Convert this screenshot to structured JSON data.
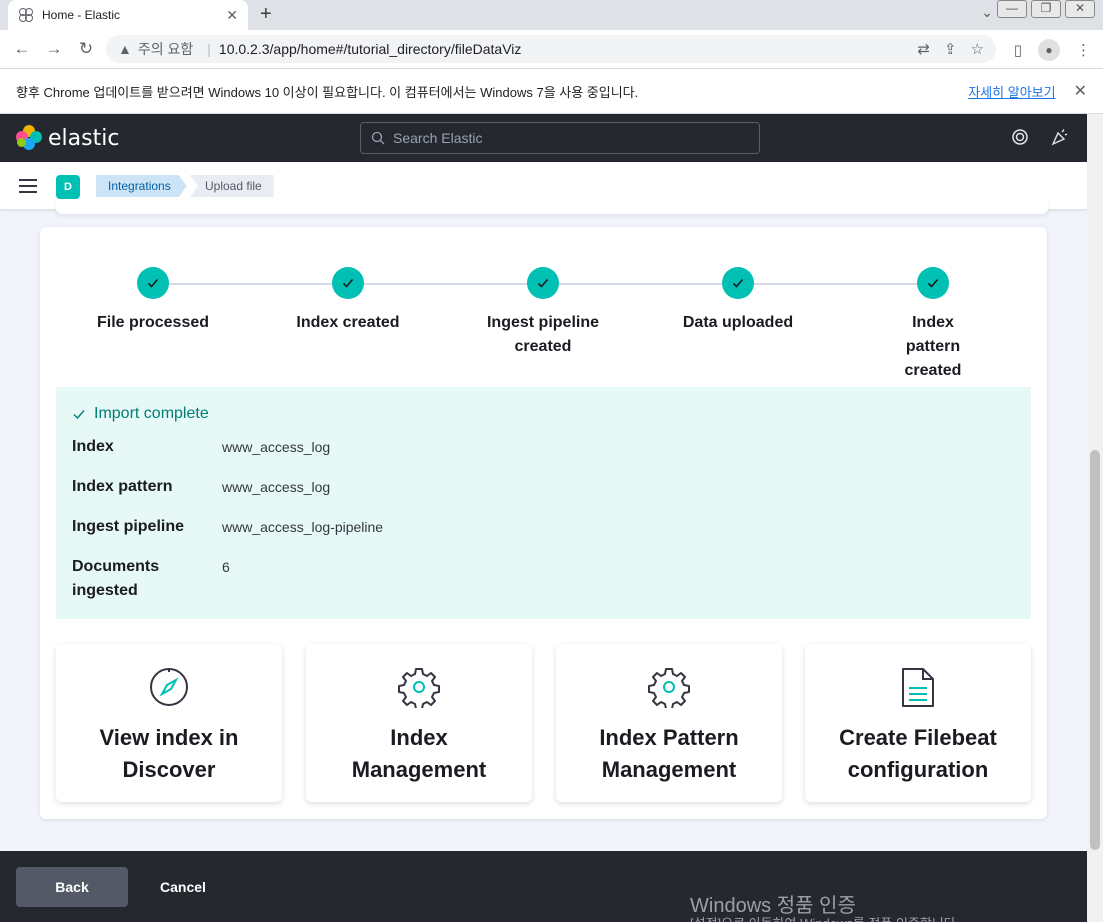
{
  "browser": {
    "tab_title": "Home - Elastic",
    "tab_close": "✕",
    "new_tab": "+",
    "security_label": "주의 요함",
    "url": "10.0.2.3/app/home#/tutorial_directory/fileDataViz",
    "window_controls": [
      "—",
      "❐",
      "✕"
    ]
  },
  "infobar": {
    "message": "향후 Chrome 업데이트를 받으려면 Windows 10 이상이 필요합니다. 이 컴퓨터에서는 Windows 7을 사용 중입니다.",
    "link": "자세히 알아보기",
    "close": "✕"
  },
  "header": {
    "logo_text": "elastic",
    "search_placeholder": "Search Elastic"
  },
  "subheader": {
    "space_initial": "D",
    "breadcrumbs": [
      "Integrations",
      "Upload file"
    ]
  },
  "steps": [
    {
      "label": "File processed"
    },
    {
      "label": "Index created"
    },
    {
      "label": "Ingest pipeline created"
    },
    {
      "label": "Data uploaded"
    },
    {
      "label": "Index pattern created"
    }
  ],
  "callout": {
    "title": "Import complete",
    "rows": [
      {
        "key": "Index",
        "value": "www_access_log"
      },
      {
        "key": "Index pattern",
        "value": "www_access_log"
      },
      {
        "key": "Ingest pipeline",
        "value": "www_access_log-pipeline"
      },
      {
        "key": "Documents ingested",
        "value": "6"
      }
    ]
  },
  "cards": [
    {
      "label": "View index in Discover",
      "icon": "compass-icon"
    },
    {
      "label": "Index Management",
      "icon": "gear-icon"
    },
    {
      "label": "Index Pattern Management",
      "icon": "gear-icon"
    },
    {
      "label": "Create Filebeat configuration",
      "icon": "document-icon"
    }
  ],
  "footer": {
    "back_label": "Back",
    "cancel_label": "Cancel"
  },
  "watermark": {
    "line1": "Windows 정품 인증",
    "line2": "[설정]으로 이동하여 Windows를 정품 인증합니다."
  },
  "colors": {
    "success": "#00bfb3",
    "callout_bg": "#e6f9f7",
    "callout_text": "#017d73",
    "header_bg": "#25282f"
  }
}
